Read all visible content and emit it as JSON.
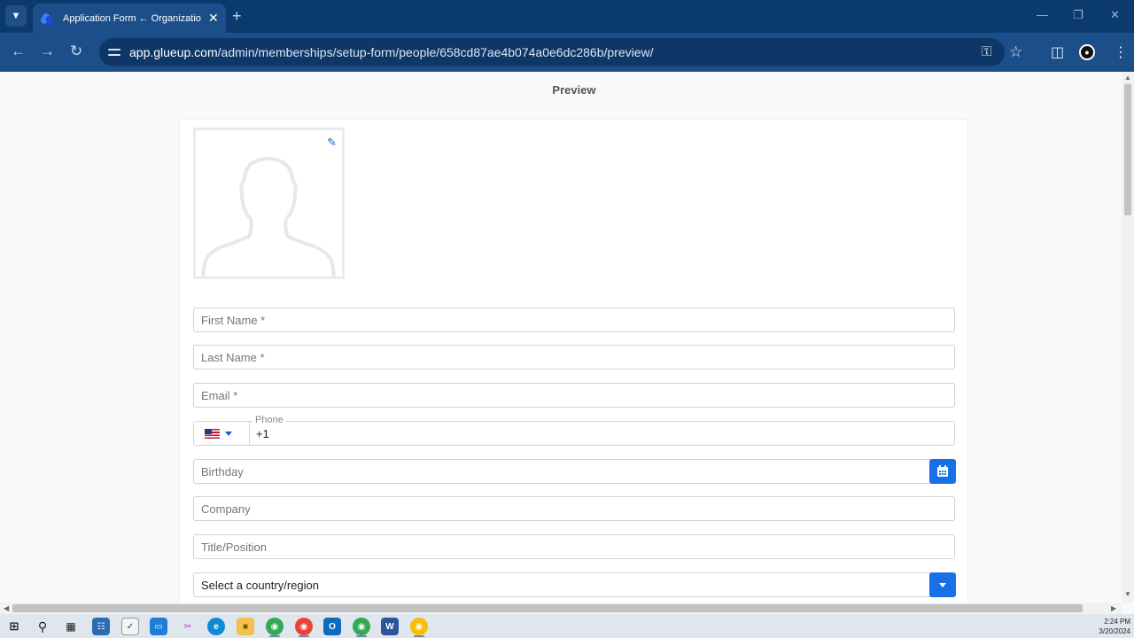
{
  "browser": {
    "tab_title": "Application Form ← Organization Settings",
    "url_host": "app.glueup.com",
    "url_path": "/admin/memberships/setup-form/people/658cd87ae4b074a0e6dc286b/preview/",
    "icons": {
      "tab_search": "chevron-down-icon",
      "tab_close": "close-icon",
      "new_tab": "plus-icon",
      "back": "arrow-left-icon",
      "forward": "arrow-right-icon",
      "reload": "reload-icon",
      "site_info": "tune-icon",
      "password": "key-icon",
      "bookmark": "star-icon",
      "side_panel": "side-panel-icon",
      "profile": "profile-icon",
      "menu": "more-vertical-icon"
    }
  },
  "page": {
    "title": "Preview"
  },
  "form": {
    "photo_edit_icon": "pencil-icon",
    "first_name_placeholder": "First Name *",
    "last_name_placeholder": "Last Name *",
    "email_placeholder": "Email *",
    "phone_label": "Phone",
    "phone_value": "+1",
    "phone_country_flag": "us-flag-icon",
    "birthday_placeholder": "Birthday",
    "birthday_button_icon": "calendar-icon",
    "company_placeholder": "Company",
    "title_placeholder": "Title/Position",
    "country_selected": "Select a country/region",
    "country_button_icon": "caret-down-icon"
  },
  "taskbar": {
    "time": "2:24 PM",
    "date": "3/20/2024",
    "apps": [
      "windows-start-icon",
      "search-icon",
      "task-view-icon",
      "calculator-icon",
      "clock-app-icon",
      "whiteboard-icon",
      "snipping-tool-icon",
      "edge-icon",
      "file-explorer-icon",
      "chrome-profile-icon",
      "chrome-icon",
      "outlook-icon",
      "chrome-profile-icon",
      "word-icon",
      "chrome-profile-icon"
    ]
  },
  "colors": {
    "accent": "#1870e8",
    "chrome_dark": "#0b3a6e",
    "chrome_toolbar": "#1c4f8a"
  }
}
